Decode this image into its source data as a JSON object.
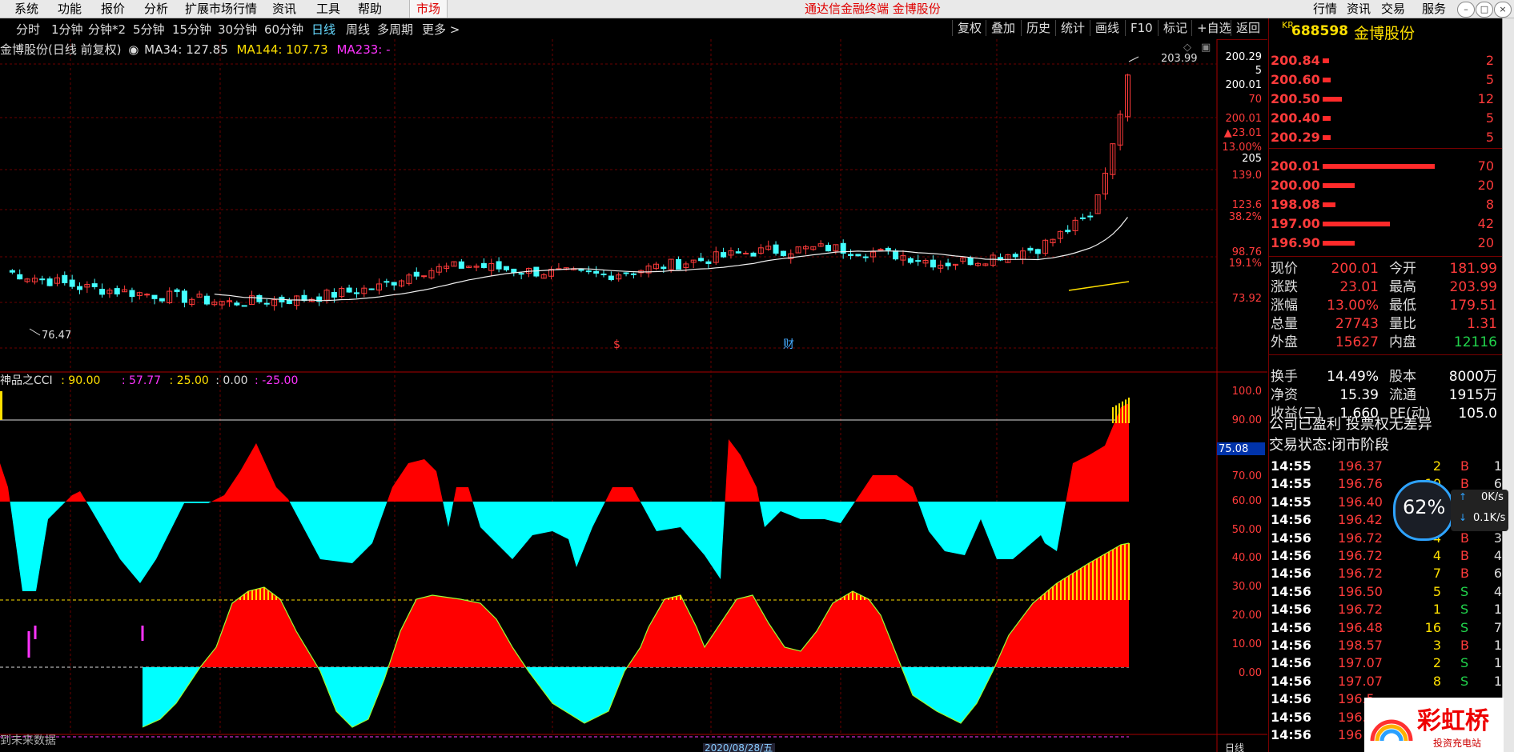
{
  "topbar": {
    "menus": [
      "系统",
      "功能",
      "报价",
      "分析",
      "扩展市场行情",
      "资讯",
      "工具",
      "帮助"
    ],
    "market": "市场",
    "title": "通达信金融终端 金博股份",
    "right_buttons": [
      "行情",
      "资讯",
      "交易",
      "服务"
    ]
  },
  "toolbar": {
    "periods": [
      "分时",
      "1分钟",
      "分钟*2",
      "5分钟",
      "15分钟",
      "30分钟",
      "60分钟",
      "日线",
      "周线",
      "多周期",
      "更多 >"
    ],
    "active_period": "日线",
    "right": [
      "复权",
      "叠加",
      "历史",
      "统计",
      "画线",
      "F10",
      "标记",
      "+自选",
      "返回"
    ]
  },
  "ma_legend": {
    "name": "金博股份(日线 前复权)",
    "ma34": "MA34: 127.85",
    "ma144": "MA144: 107.73",
    "ma233": "MA233: -"
  },
  "cci_legend": {
    "name": "神品之CCI",
    "v1": ": 90.00",
    "v2": ": 57.77",
    "v3": ": 25.00",
    "v4": ": 0.00",
    "v5": ": -25.00"
  },
  "price_chart": {
    "high_label": "203.99",
    "low_label": "76.47",
    "axis_labels": [
      "200.29",
      "5",
      "200.01",
      "70",
      "200.01",
      "▲23.01",
      "13.00%",
      "205",
      "139.0",
      "123.6",
      "38.2%",
      "98.76",
      "19.1%",
      "73.92"
    ],
    "markers": [
      "$",
      "财"
    ]
  },
  "cci_axis": [
    "100.0",
    "90.00",
    "75.08",
    "70.00",
    "60.00",
    "50.00",
    "40.00",
    "30.00",
    "20.00",
    "10.00",
    "0.00"
  ],
  "bottom": {
    "note": "到未来数据",
    "date_tag": "2020/08/28/五",
    "right_tag": "日线"
  },
  "quote_panel": {
    "code_prefix": "KR",
    "code": "688598",
    "name": "金博股份",
    "asks": [
      {
        "price": "200.84",
        "vol": "2"
      },
      {
        "price": "200.60",
        "vol": "5"
      },
      {
        "price": "200.50",
        "vol": "12"
      },
      {
        "price": "200.40",
        "vol": "5"
      },
      {
        "price": "200.29",
        "vol": "5"
      }
    ],
    "bids": [
      {
        "price": "200.01",
        "vol": "70"
      },
      {
        "price": "200.00",
        "vol": "20"
      },
      {
        "price": "198.08",
        "vol": "8"
      },
      {
        "price": "197.00",
        "vol": "42"
      },
      {
        "price": "196.90",
        "vol": "20"
      }
    ],
    "stats": [
      {
        "l1": "现价",
        "v1": "200.01",
        "l2": "今开",
        "v2": "181.99"
      },
      {
        "l1": "涨跌",
        "v1": "23.01",
        "l2": "最高",
        "v2": "203.99"
      },
      {
        "l1": "涨幅",
        "v1": "13.00%",
        "l2": "最低",
        "v2": "179.51"
      },
      {
        "l1": "总量",
        "v1": "27743",
        "l2": "量比",
        "v2": "1.31"
      },
      {
        "l1": "外盘",
        "v1": "15627",
        "l2": "内盘",
        "v2": "12116"
      },
      {
        "l1": "换手",
        "v1": "14.49%",
        "l2": "股本",
        "v2": "8000万"
      },
      {
        "l1": "净资",
        "v1": "15.39",
        "l2": "流通",
        "v2": "1915万"
      },
      {
        "l1": "收益(三)",
        "v1": "1.660",
        "l2": "PE(动)",
        "v2": "105.0"
      }
    ],
    "notice": "公司已盈利 投票权无差异",
    "status": "交易状态:闭市阶段",
    "trades": [
      {
        "t": "14:55",
        "p": "196.37",
        "v": "2",
        "d": "B",
        "n": "1"
      },
      {
        "t": "14:55",
        "p": "196.76",
        "v": "10",
        "d": "B",
        "n": "6"
      },
      {
        "t": "14:55",
        "p": "196.40",
        "v": "",
        "d": "",
        "n": ""
      },
      {
        "t": "14:56",
        "p": "196.42",
        "v": "",
        "d": "",
        "n": ""
      },
      {
        "t": "14:56",
        "p": "196.72",
        "v": "4",
        "d": "B",
        "n": "3"
      },
      {
        "t": "14:56",
        "p": "196.72",
        "v": "4",
        "d": "B",
        "n": "4"
      },
      {
        "t": "14:56",
        "p": "196.72",
        "v": "7",
        "d": "B",
        "n": "6"
      },
      {
        "t": "14:56",
        "p": "196.50",
        "v": "5",
        "d": "S",
        "n": "4"
      },
      {
        "t": "14:56",
        "p": "196.72",
        "v": "1",
        "d": "S",
        "n": "1"
      },
      {
        "t": "14:56",
        "p": "196.48",
        "v": "16",
        "d": "S",
        "n": "7"
      },
      {
        "t": "14:56",
        "p": "198.57",
        "v": "3",
        "d": "B",
        "n": "1"
      },
      {
        "t": "14:56",
        "p": "197.07",
        "v": "2",
        "d": "S",
        "n": "1"
      },
      {
        "t": "14:56",
        "p": "197.07",
        "v": "8",
        "d": "S",
        "n": "1"
      },
      {
        "t": "14:56",
        "p": "196.5",
        "v": "",
        "d": "",
        "n": ""
      },
      {
        "t": "14:56",
        "p": "196.",
        "v": "",
        "d": "",
        "n": ""
      },
      {
        "t": "14:56",
        "p": "196",
        "v": "",
        "d": "",
        "n": ""
      }
    ]
  },
  "widget": {
    "percent": "62%",
    "up": "0K/s",
    "down": "0.1K/s"
  },
  "logo": {
    "text": "彩虹桥",
    "sub": "投资充电站"
  },
  "colors": {
    "up": "#ff3b3b",
    "down": "#21d44c",
    "cyan": "#00ffff",
    "yellow": "#ffe000",
    "magenta": "#ff33ff"
  }
}
